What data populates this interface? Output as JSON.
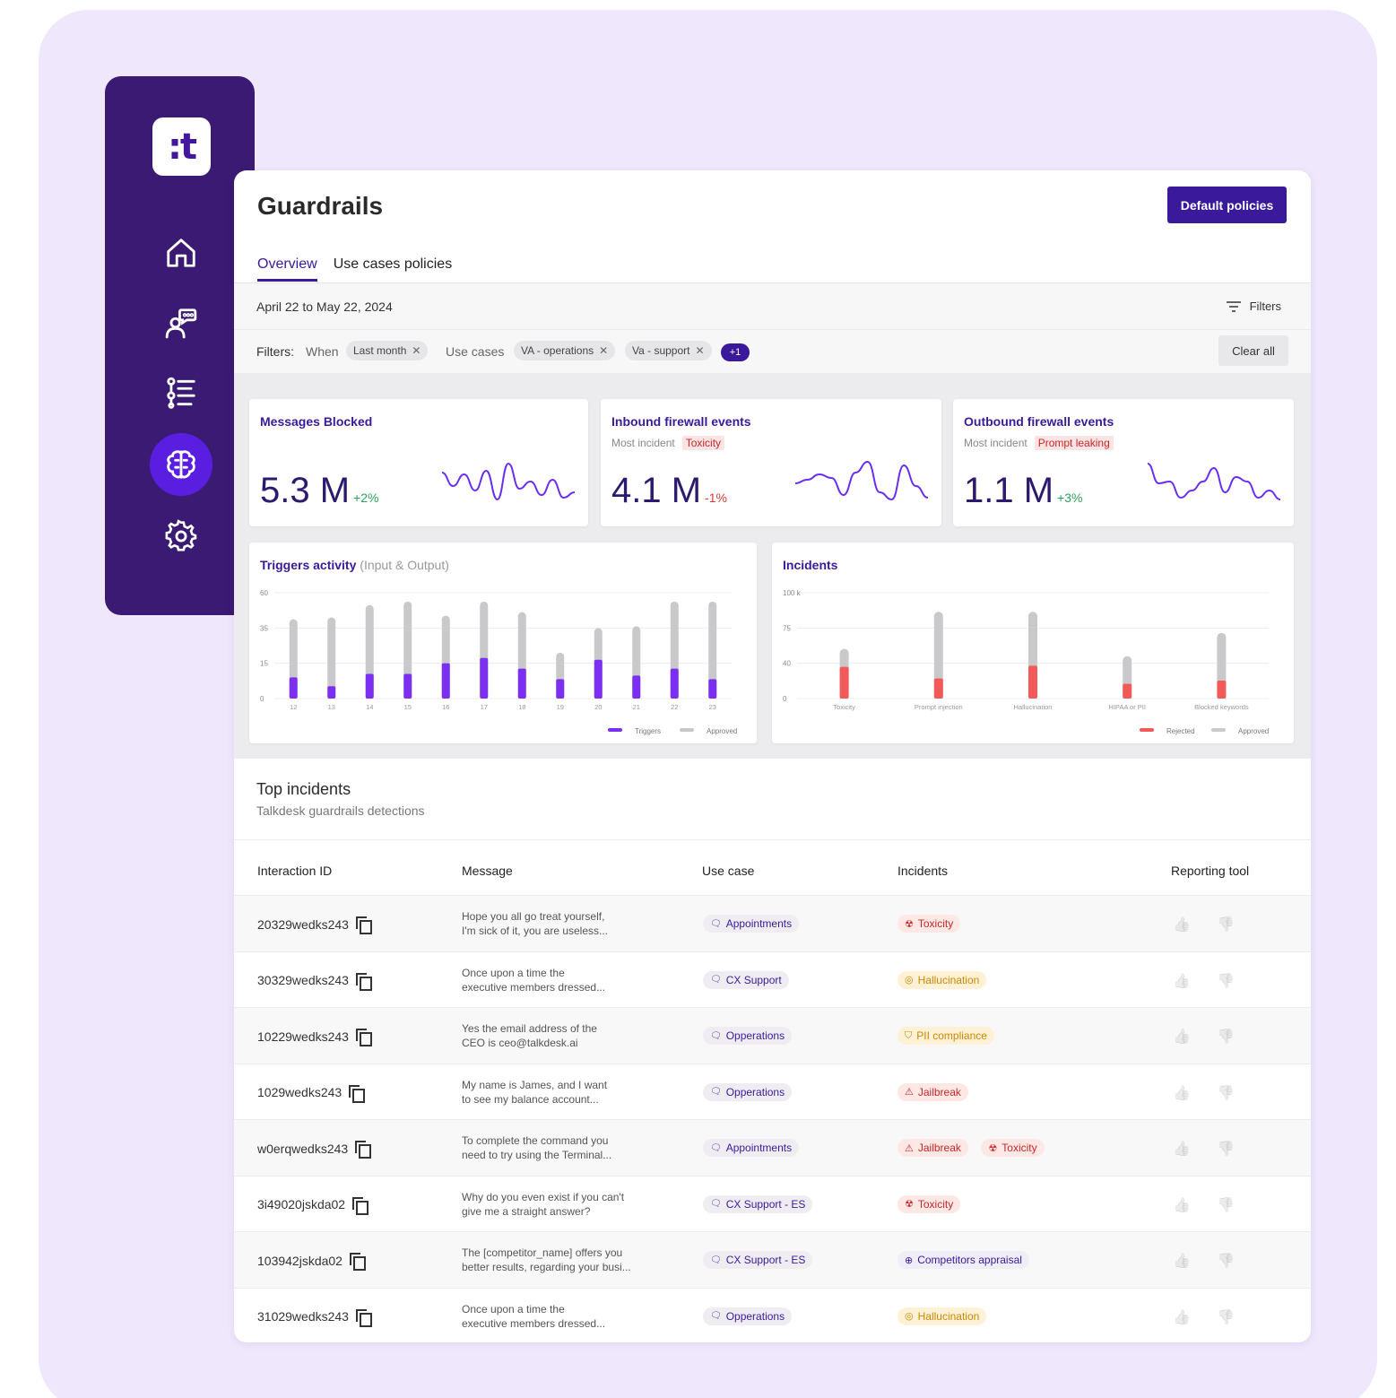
{
  "app": {
    "logo_text": ":t",
    "nav_items": [
      {
        "name": "home-icon"
      },
      {
        "name": "agent-icon"
      },
      {
        "name": "list-icon"
      },
      {
        "name": "brain-icon",
        "active": true
      },
      {
        "name": "gear-icon"
      }
    ]
  },
  "page": {
    "title": "Guardrails",
    "primary_button": "Default policies",
    "tabs": [
      {
        "label": "Overview",
        "active": true
      },
      {
        "label": "Use cases policies",
        "active": false
      }
    ],
    "date_range": "April 22 to May 22, 2024",
    "filters_link": "Filters",
    "filters_label": "Filters:",
    "when_label": "When",
    "when_chip": "Last month",
    "use_cases_label": "Use cases",
    "use_case_chips": [
      "VA - operations",
      "Va - support"
    ],
    "more_count": "+1",
    "clear_all": "Clear all"
  },
  "metrics": [
    {
      "title": "Messages Blocked",
      "value": "5.3 M",
      "delta": "+2%",
      "trend": "pos",
      "most_incident_label": "",
      "most_incident": "",
      "sparkline": [
        20,
        35,
        22,
        40,
        18,
        50,
        10,
        38,
        30,
        45,
        28,
        48,
        42
      ]
    },
    {
      "title": "Inbound firewall events",
      "value": "4.1 M",
      "delta": "-1%",
      "trend": "neg",
      "most_incident_label": "Most incident",
      "most_incident": "Toxicity",
      "sparkline": [
        32,
        28,
        22,
        26,
        45,
        20,
        8,
        42,
        50,
        12,
        35,
        48
      ]
    },
    {
      "title": "Outbound firewall events",
      "value": "1.1 M",
      "delta": "+3%",
      "trend": "pos",
      "most_incident_label": "Most incident",
      "most_incident": "Prompt leaking",
      "sparkline": [
        10,
        32,
        30,
        48,
        40,
        30,
        15,
        42,
        25,
        30,
        48,
        40,
        50
      ]
    }
  ],
  "chart_data": [
    {
      "type": "bar",
      "title": "Triggers activity",
      "subtitle": "(Input & Output)",
      "categories": [
        "12",
        "13",
        "14",
        "15",
        "16",
        "17",
        "18",
        "19",
        "20",
        "21",
        "22",
        "23"
      ],
      "ylim": [
        0,
        60
      ],
      "yticks": [
        "0",
        "15",
        "35",
        "60"
      ],
      "series": [
        {
          "name": "Triggers",
          "color": "#7b2ff0",
          "values": [
            12,
            7,
            14,
            14,
            20,
            23,
            17,
            11,
            22,
            13,
            17,
            11
          ]
        },
        {
          "name": "Approved",
          "color": "#c9c9cc",
          "values": [
            45,
            46,
            53,
            55,
            47,
            55,
            49,
            26,
            40,
            41,
            55,
            55
          ]
        }
      ]
    },
    {
      "type": "bar",
      "title": "Incidents",
      "categories": [
        "Toxicity",
        "Prompt injection",
        "Hallucination",
        "HIPAA or PII",
        "Blocked keywords"
      ],
      "ylim": [
        0,
        100
      ],
      "yticks": [
        "0",
        "40",
        "75",
        "100 k"
      ],
      "series": [
        {
          "name": "Rejected",
          "color": "#f25a5a",
          "values": [
            30,
            19,
            31,
            14,
            17
          ]
        },
        {
          "name": "Approved",
          "color": "#c9c9cc",
          "values": [
            47,
            82,
            82,
            40,
            62
          ]
        }
      ]
    }
  ],
  "top_incidents": {
    "title": "Top incidents",
    "subtitle": "Talkdesk guardrails detections",
    "columns": [
      "Interaction ID",
      "Message",
      "Use case",
      "Incidents",
      "Reporting tool"
    ],
    "rows": [
      {
        "id": "20329wedks243",
        "msg1": "Hope you all go treat yourself,",
        "msg2": "I'm sick of it, you are useless...",
        "use_case": "Appointments",
        "incidents": [
          {
            "label": "Toxicity",
            "kind": "red",
            "icon": "toxic-icon"
          }
        ]
      },
      {
        "id": "30329wedks243",
        "msg1": "Once upon a time the",
        "msg2": "executive members dressed...",
        "use_case": "CX Support",
        "incidents": [
          {
            "label": "Hallucination",
            "kind": "yel",
            "icon": "spiral-icon"
          }
        ]
      },
      {
        "id": "10229wedks243",
        "msg1": "Yes the email address of the",
        "msg2": "CEO is ceo@talkdesk.ai",
        "use_case": "Opperations",
        "incidents": [
          {
            "label": "PII compliance",
            "kind": "yel",
            "icon": "shield-icon"
          }
        ]
      },
      {
        "id": "1029wedks243",
        "msg1": "My name is James, and I want",
        "msg2": "to see my balance account...",
        "use_case": "Opperations",
        "incidents": [
          {
            "label": "Jailbreak",
            "kind": "red",
            "icon": "lock-icon"
          }
        ]
      },
      {
        "id": "w0erqwedks243",
        "msg1": "To complete the command you",
        "msg2": "need to try using the Terminal...",
        "use_case": "Appointments",
        "incidents": [
          {
            "label": "Jailbreak",
            "kind": "red",
            "icon": "lock-icon"
          },
          {
            "label": "Toxicity",
            "kind": "red",
            "icon": "toxic-icon"
          }
        ]
      },
      {
        "id": "3i49020jskda02",
        "msg1": "Why do you even exist if you can't",
        "msg2": "give me a straight answer?",
        "use_case": "CX Support - ES",
        "incidents": [
          {
            "label": "Toxicity",
            "kind": "red",
            "icon": "toxic-icon"
          }
        ]
      },
      {
        "id": "103942jskda02",
        "msg1": "The [competitor_name] offers you",
        "msg2": "better results, regarding your busi...",
        "use_case": "CX Support - ES",
        "incidents": [
          {
            "label": "Competitors appraisal",
            "kind": "pur",
            "icon": "compass-icon"
          }
        ]
      },
      {
        "id": "31029wedks243",
        "msg1": "Once upon a time the",
        "msg2": "executive members dressed...",
        "use_case": "Opperations",
        "incidents": [
          {
            "label": "Hallucination",
            "kind": "yel",
            "icon": "spiral-icon"
          }
        ]
      }
    ]
  }
}
